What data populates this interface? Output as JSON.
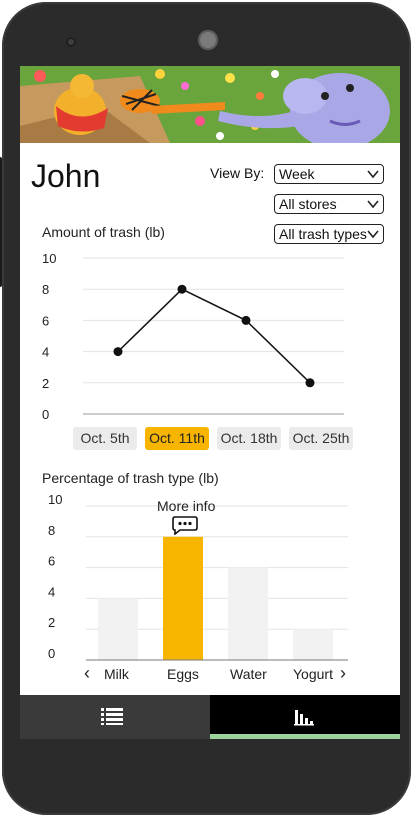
{
  "user": {
    "name": "John"
  },
  "filters": {
    "view_by_label": "View By:",
    "period": "Week",
    "store": "All stores",
    "trash_type": "All trash types"
  },
  "line_section": {
    "title": "Amount of trash (lb)",
    "dates": [
      "Oct. 5th",
      "Oct. 11th",
      "Oct. 18th",
      "Oct. 25th"
    ],
    "selected_index": 1
  },
  "bar_section": {
    "title": "Percentage of trash type (lb)",
    "more_info": "More info",
    "prev_glyph": "‹",
    "next_glyph": "›"
  },
  "chart_data": [
    {
      "type": "line",
      "title": "Amount of trash (lb)",
      "categories": [
        "Oct. 5th",
        "Oct. 11th",
        "Oct. 18th",
        "Oct. 25th"
      ],
      "values": [
        4,
        8,
        6,
        2
      ],
      "ylim": [
        0,
        10
      ],
      "yticks": [
        "0",
        "2",
        "4",
        "6",
        "8",
        "10"
      ],
      "grid": true
    },
    {
      "type": "bar",
      "title": "Percentage of trash type (lb)",
      "categories": [
        "Milk",
        "Eggs",
        "Water",
        "Yogurt"
      ],
      "values": [
        4,
        8,
        6,
        2
      ],
      "highlight_index": 1,
      "ylim": [
        0,
        10
      ],
      "yticks": [
        "0",
        "2",
        "4",
        "6",
        "8",
        "10"
      ],
      "grid": true
    }
  ],
  "colors": {
    "accent": "#f7b500",
    "bar_default": "#f2f2f2",
    "grid": "#e3e3e3",
    "line": "#111111",
    "nav_left": "#3a3a3a",
    "nav_right": "#000000",
    "nav_indicator": "#9bd39a"
  },
  "icons": {
    "nav_list": "list-icon",
    "nav_chart": "bar-chart-icon",
    "more_info": "chat-bubble-icon"
  }
}
